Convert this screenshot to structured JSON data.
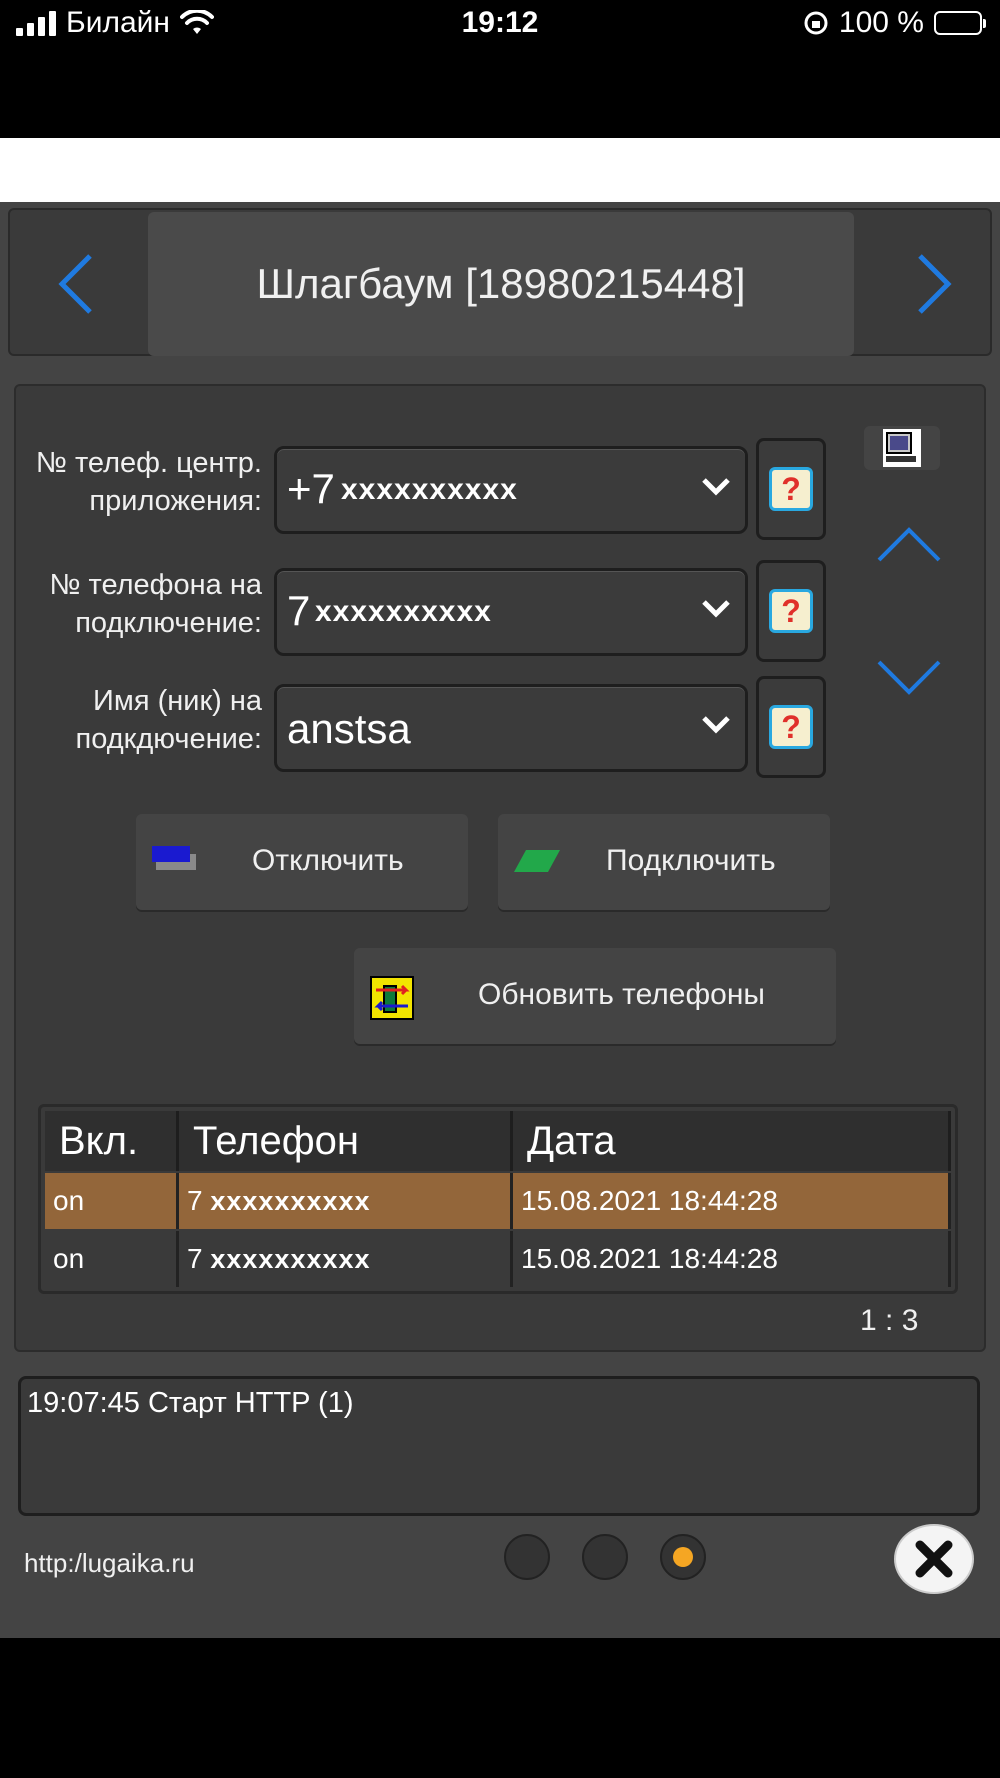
{
  "status_bar": {
    "carrier": "Билайн",
    "time": "19:12",
    "battery": "100 %"
  },
  "header": {
    "title": "Шлагбаум [18980215448]"
  },
  "form": {
    "center_phone": {
      "label_line1": "№ телеф. центр.",
      "label_line2": "приложения:",
      "prefix": "+7",
      "value": "xxxxxxxxxx"
    },
    "connect_phone": {
      "label_line1": "№ телефона на",
      "label_line2": "подключение:",
      "prefix": "7",
      "value": "xxxxxxxxxx"
    },
    "nick": {
      "label_line1": "Имя (ник) на",
      "label_line2": "подкдючение:",
      "value": "anstsa"
    },
    "help_icon": "?"
  },
  "buttons": {
    "disconnect": "Отключить",
    "connect": "Подключить",
    "refresh": "Обновить телефоны"
  },
  "table": {
    "headers": [
      "Вкл.",
      "Телефон",
      "Дата"
    ],
    "rows": [
      {
        "on": "on",
        "prefix": "7",
        "phone": "xxxxxxxxxx",
        "date": "15.08.2021 18:44:28"
      },
      {
        "on": "on",
        "prefix": "7",
        "phone": "xxxxxxxxxx",
        "date": "15.08.2021 18:44:28"
      }
    ],
    "pager": "1 : 3"
  },
  "log": {
    "text": "19:07:45 Старт HTTP (1)"
  },
  "footer": {
    "link": "http:/lugaika.ru",
    "active_page": 3
  },
  "colors": {
    "accent_blue": "#1f7ae0",
    "selected_row": "#93663a",
    "active_dot": "#f5a623"
  }
}
